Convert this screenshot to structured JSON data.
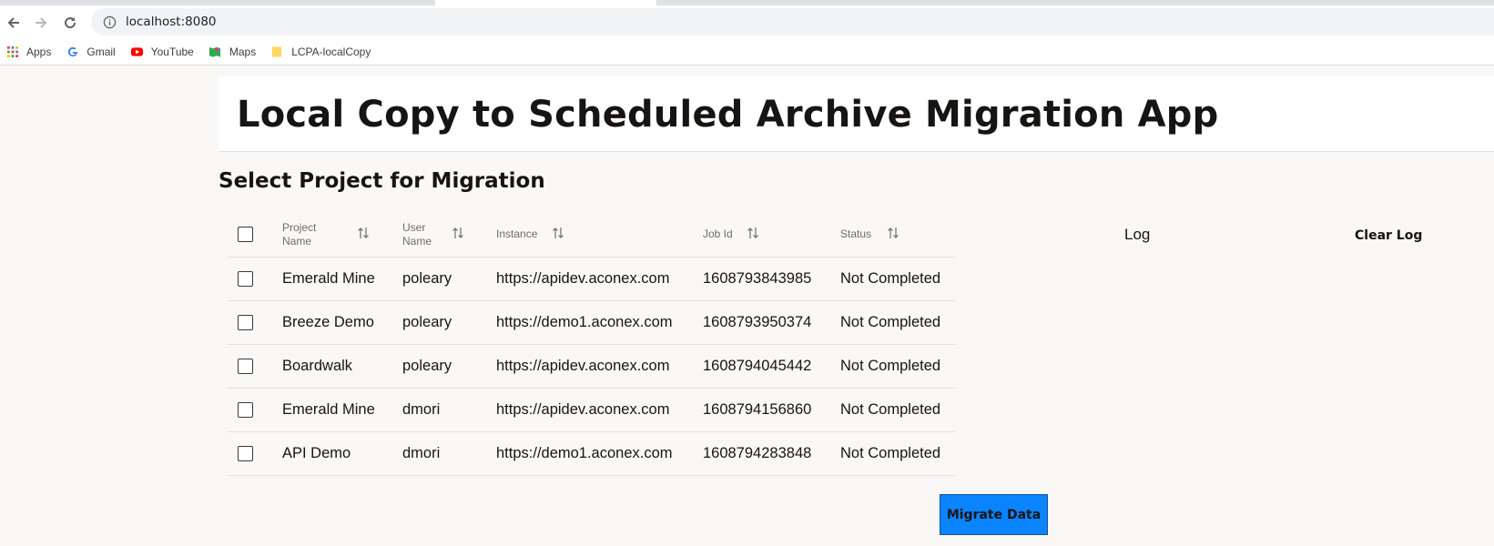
{
  "browser": {
    "url": "localhost:8080",
    "bookmarks": [
      {
        "label": "Apps",
        "icon": "apps-grid-icon"
      },
      {
        "label": "Gmail",
        "icon": "google-g-icon"
      },
      {
        "label": "YouTube",
        "icon": "youtube-icon"
      },
      {
        "label": "Maps",
        "icon": "maps-icon"
      },
      {
        "label": "LCPA-localCopy",
        "icon": "folder-icon"
      }
    ]
  },
  "app": {
    "title": "Local Copy to Scheduled Archive Migration App",
    "section_title": "Select Project for Migration"
  },
  "table": {
    "headers": {
      "project_name": [
        "Project",
        "Name"
      ],
      "user_name": [
        "User",
        "Name"
      ],
      "instance": "Instance",
      "job_id": "Job Id",
      "status": "Status"
    },
    "rows": [
      {
        "project": "Emerald Mine",
        "user": "poleary",
        "instance": "https://apidev.aconex.com",
        "job_id": "1608793843985",
        "status": "Not Completed"
      },
      {
        "project": "Breeze Demo",
        "user": "poleary",
        "instance": "https://demo1.aconex.com",
        "job_id": "1608793950374",
        "status": "Not Completed"
      },
      {
        "project": "Boardwalk",
        "user": "poleary",
        "instance": "https://apidev.aconex.com",
        "job_id": "1608794045442",
        "status": "Not Completed"
      },
      {
        "project": "Emerald Mine",
        "user": "dmori",
        "instance": "https://apidev.aconex.com",
        "job_id": "1608794156860",
        "status": "Not Completed"
      },
      {
        "project": "API Demo",
        "user": "dmori",
        "instance": "https://demo1.aconex.com",
        "job_id": "1608794283848",
        "status": "Not Completed"
      }
    ]
  },
  "log": {
    "label": "Log",
    "clear_label": "Clear Log"
  },
  "actions": {
    "migrate_label": "Migrate Data"
  },
  "colors": {
    "primary_button": "#0a84ff",
    "page_background": "#f9f8f6"
  }
}
